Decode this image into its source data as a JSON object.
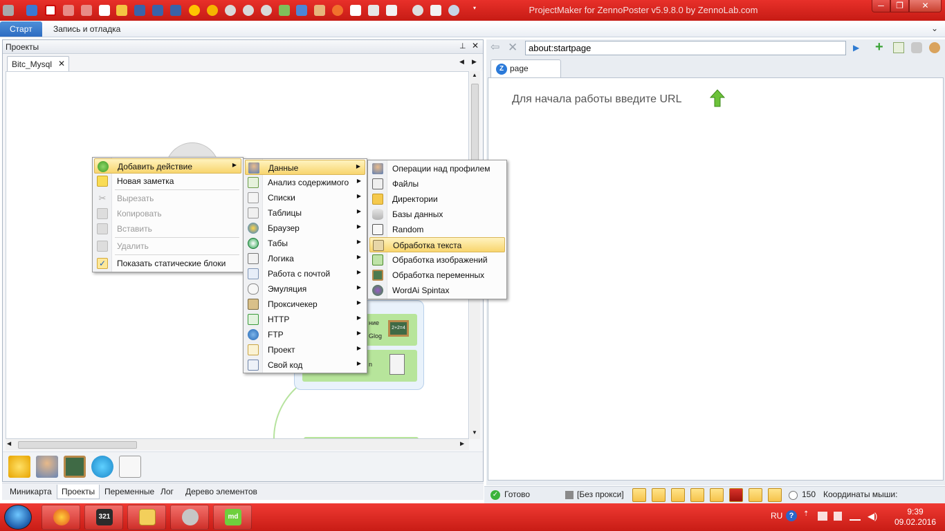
{
  "app": {
    "title": "ProjectMaker for ZennoPoster v5.9.8.0 by ZennoLab.com"
  },
  "ribbon": {
    "tabs": [
      "Старт",
      "Запись и отладка"
    ]
  },
  "projects_panel": {
    "title": "Проекты",
    "doc_tab": "Bitc_Mysql",
    "close_glyph": "✕",
    "pin_glyph": "⊥"
  },
  "canvas": {
    "node_text_1": "ние",
    "node_text_2": "Glog",
    "node_text_3": "n",
    "board_text": "2+2=4"
  },
  "bottom_tabs": [
    "Миникарта",
    "Проекты",
    "Переменные",
    "Лог",
    "Дерево элементов"
  ],
  "browser": {
    "url": "about:startpage",
    "tab_label": "page",
    "hint": "Для начала работы введите URL"
  },
  "context_menu": {
    "items": [
      {
        "label": "Добавить действие",
        "icon": "plus-circle-icon",
        "submenu": true
      },
      {
        "label": "Новая заметка",
        "icon": "note-icon"
      },
      {
        "label": "Вырезать",
        "icon": "scissors-icon",
        "disabled": true
      },
      {
        "label": "Копировать",
        "icon": "copy-icon",
        "disabled": true
      },
      {
        "label": "Вставить",
        "icon": "paste-icon",
        "disabled": true
      },
      {
        "label": "Удалить",
        "icon": "delete-icon",
        "disabled": true
      },
      {
        "label": "Показать статические блоки",
        "icon": "checkmark-icon"
      }
    ]
  },
  "action_menu": {
    "items": [
      {
        "label": "Данные",
        "icon": "user-data-icon"
      },
      {
        "label": "Анализ содержимого",
        "icon": "analyze-icon"
      },
      {
        "label": "Списки",
        "icon": "list-icon"
      },
      {
        "label": "Таблицы",
        "icon": "table-icon"
      },
      {
        "label": "Браузер",
        "icon": "browser-icon"
      },
      {
        "label": "Табы",
        "icon": "tabs-icon"
      },
      {
        "label": "Логика",
        "icon": "logic-icon"
      },
      {
        "label": "Работа с почтой",
        "icon": "mail-icon"
      },
      {
        "label": "Эмуляция",
        "icon": "mouse-icon"
      },
      {
        "label": "Проксичекер",
        "icon": "proxy-icon"
      },
      {
        "label": "HTTP",
        "icon": "http-icon"
      },
      {
        "label": "FTP",
        "icon": "ftp-icon"
      },
      {
        "label": "Проект",
        "icon": "project-icon"
      },
      {
        "label": "Свой код",
        "icon": "code-icon"
      }
    ]
  },
  "data_menu": {
    "items": [
      {
        "label": "Операции над профилем",
        "icon": "profile-icon"
      },
      {
        "label": "Файлы",
        "icon": "file-icon"
      },
      {
        "label": "Директории",
        "icon": "folder-icon"
      },
      {
        "label": "Базы данных",
        "icon": "database-icon"
      },
      {
        "label": "Random",
        "icon": "dice-icon"
      },
      {
        "label": "Обработка текста",
        "icon": "text-edit-icon"
      },
      {
        "label": "Обработка изображений",
        "icon": "image-icon"
      },
      {
        "label": "Обработка переменных",
        "icon": "variable-icon"
      },
      {
        "label": "WordAi Spintax",
        "icon": "wordai-icon"
      }
    ]
  },
  "statusbar": {
    "ready": "Готово",
    "proxy": "[Без прокси]",
    "timer": "150",
    "mouse": "Координаты мыши:"
  },
  "taskbar": {
    "lang": "RU",
    "time": "9:39",
    "date": "09.02.2016",
    "app_label": "321"
  }
}
